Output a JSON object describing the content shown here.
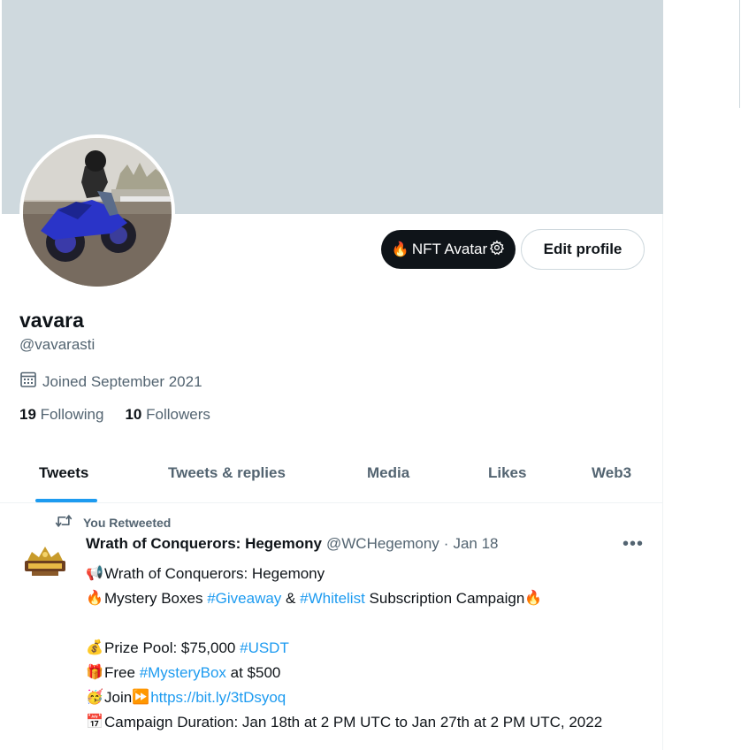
{
  "profile": {
    "display_name": "vavara",
    "handle": "@vavarasti",
    "joined": "Joined September 2021",
    "following_count": "19",
    "following_label": "Following",
    "followers_count": "10",
    "followers_label": "Followers"
  },
  "buttons": {
    "nft_avatar": "NFT Avatar",
    "edit_profile": "Edit profile"
  },
  "tabs": [
    {
      "label": "Tweets",
      "active": true
    },
    {
      "label": "Tweets & replies",
      "active": false
    },
    {
      "label": "Media",
      "active": false
    },
    {
      "label": "Likes",
      "active": false
    },
    {
      "label": "Web3",
      "active": false
    }
  ],
  "tweet": {
    "retweet_label": "You Retweeted",
    "author": "Wrath of Conquerors: Hegemony",
    "author_handle": "@WCHegemony",
    "separator": "·",
    "date": "Jan 18",
    "lines": {
      "l1": "Wrath of Conquerors: Hegemony",
      "l2_a": "Mystery Boxes ",
      "l2_tag1": "#Giveaway",
      "l2_b": " & ",
      "l2_tag2": "#Whitelist",
      "l2_c": " Subscription Campaign",
      "l3_a": "Prize Pool: $75,000 ",
      "l3_tag": "#USDT",
      "l4_a": "Free ",
      "l4_tag": "#MysteryBox",
      "l4_b": " at $500",
      "l5_a": "Join",
      "l5_link": "https://bit.ly/3tDsyoq",
      "l6": "Campaign Duration: Jan 18th at 2 PM UTC to Jan 27th at 2 PM UTC, 2022"
    }
  },
  "icons": {
    "emoji": [
      "megaphone-icon",
      "fire-icon",
      "money-bag-icon",
      "gift-icon",
      "face-icon",
      "fast-forward-icon",
      "calendar-icon"
    ]
  },
  "colors": {
    "accent": "#1d9bf0",
    "banner": "#cfd9de",
    "text_primary": "#0f1419",
    "text_secondary": "#536471"
  }
}
